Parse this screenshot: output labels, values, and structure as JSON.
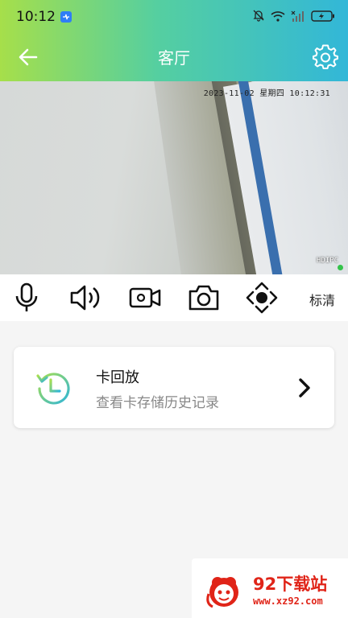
{
  "status_bar": {
    "time": "10:12",
    "icons": [
      "notification-badge",
      "mute-icon",
      "wifi-icon",
      "signal-icon",
      "battery-charging-icon"
    ]
  },
  "header": {
    "title": "客厅",
    "back_icon": "arrow-left-icon",
    "settings_icon": "gear-icon"
  },
  "video": {
    "osd_time": "2023-11-02  星期四  10:12:31",
    "osd_label": "HDIPC",
    "live_indicator_color": "#34c34a"
  },
  "toolbar": {
    "tools": [
      "microphone-icon",
      "speaker-icon",
      "record-video-icon",
      "snapshot-camera-icon",
      "ptz-direction-icon"
    ],
    "quality_label": "标清"
  },
  "playback_card": {
    "title": "卡回放",
    "subtitle": "查看卡存储历史记录",
    "icon": "history-clock-icon",
    "arrow": "chevron-right-icon"
  },
  "watermark": {
    "title": "92下载站",
    "url": "www.xz92.com"
  },
  "colors": {
    "header_gradient_start": "#a6df4a",
    "header_gradient_end": "#32b7d8",
    "brand_red": "#e02418"
  }
}
